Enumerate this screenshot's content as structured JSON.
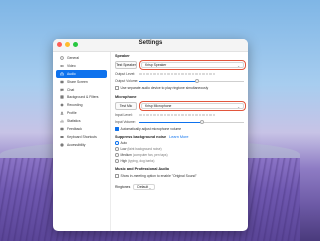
{
  "window": {
    "title": "Settings"
  },
  "sidebar": {
    "items": [
      {
        "label": "General",
        "icon": "gear-icon",
        "active": false
      },
      {
        "label": "Video",
        "icon": "video-icon",
        "active": false
      },
      {
        "label": "Audio",
        "icon": "headphones-icon",
        "active": true
      },
      {
        "label": "Share Screen",
        "icon": "share-screen-icon",
        "active": false
      },
      {
        "label": "Chat",
        "icon": "chat-icon",
        "active": false
      },
      {
        "label": "Background & Filters",
        "icon": "background-icon",
        "active": false
      },
      {
        "label": "Recording",
        "icon": "record-icon",
        "active": false
      },
      {
        "label": "Profile",
        "icon": "profile-icon",
        "active": false
      },
      {
        "label": "Statistics",
        "icon": "statistics-icon",
        "active": false
      },
      {
        "label": "Feedback",
        "icon": "feedback-icon",
        "active": false
      },
      {
        "label": "Keyboard Shortcuts",
        "icon": "keyboard-icon",
        "active": false
      },
      {
        "label": "Accessibility",
        "icon": "accessibility-icon",
        "active": false
      }
    ]
  },
  "speaker": {
    "heading": "Speaker",
    "test_label": "Test Speaker",
    "device": "Krisp Speaker",
    "output_level_label": "Output Level:",
    "output_volume_label": "Output Volume:",
    "output_volume": 0.55,
    "separate_device_label": "Use separate audio device to play ringtone simultaneously"
  },
  "microphone": {
    "heading": "Microphone",
    "test_label": "Test Mic",
    "device": "Krisp Microphone",
    "input_level_label": "Input Level:",
    "input_volume_label": "Input Volume:",
    "input_volume": 0.6,
    "auto_adjust_label": "Automatically adjust microphone volume"
  },
  "suppress": {
    "heading": "Suppress background noise",
    "learn_more": "Learn More",
    "options": [
      {
        "label": "Auto",
        "desc": "",
        "checked": true
      },
      {
        "label": "Low",
        "desc": "(faint background noise)",
        "checked": false
      },
      {
        "label": "Medium",
        "desc": "(computer fan, pen taps)",
        "checked": false
      },
      {
        "label": "High",
        "desc": "(typing, dog barks)",
        "checked": false
      }
    ]
  },
  "music": {
    "heading": "Music and Professional Audio",
    "original_sound_label": "Show in-meeting option to enable \"Original Sound\""
  },
  "ringtone": {
    "label": "Ringtones",
    "value": "Default"
  },
  "colors": {
    "accent": "#0e72ed",
    "highlight": "#e2563d"
  }
}
